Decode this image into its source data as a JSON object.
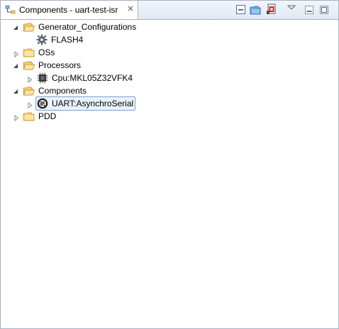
{
  "tab": {
    "title": "Components - uart-test-isr",
    "icon": "component-inspector-icon",
    "close_icon": "close-icon"
  },
  "toolbar": {
    "buttons": [
      {
        "name": "collapse-all-icon"
      },
      {
        "name": "open-folder-icon"
      },
      {
        "name": "new-component-icon"
      }
    ],
    "view_menu_icon": "view-menu-chevron-icon",
    "minimize_icon": "minimize-icon",
    "maximize_icon": "maximize-icon"
  },
  "tree": {
    "generator_configurations": {
      "label": "Generator_Configurations",
      "expanded": true
    },
    "flash4": {
      "label": "FLASH4",
      "icon": "gear-icon"
    },
    "oss": {
      "label": "OSs",
      "expanded": false
    },
    "processors": {
      "label": "Processors",
      "expanded": true
    },
    "cpu": {
      "label": "Cpu:MKL05Z32VFK4",
      "icon": "cpu-chip-icon"
    },
    "components": {
      "label": "Components",
      "expanded": true
    },
    "uart": {
      "label": "UART:AsynchroSerial",
      "icon": "serial-component-icon",
      "selected": true
    },
    "pdd": {
      "label": "PDD",
      "expanded": false
    }
  },
  "colors": {
    "folder": "#e8b64a",
    "selection_border": "#7da2ce",
    "selection_fill": "#eaf2fb",
    "frame_border": "#a7b3c2"
  }
}
